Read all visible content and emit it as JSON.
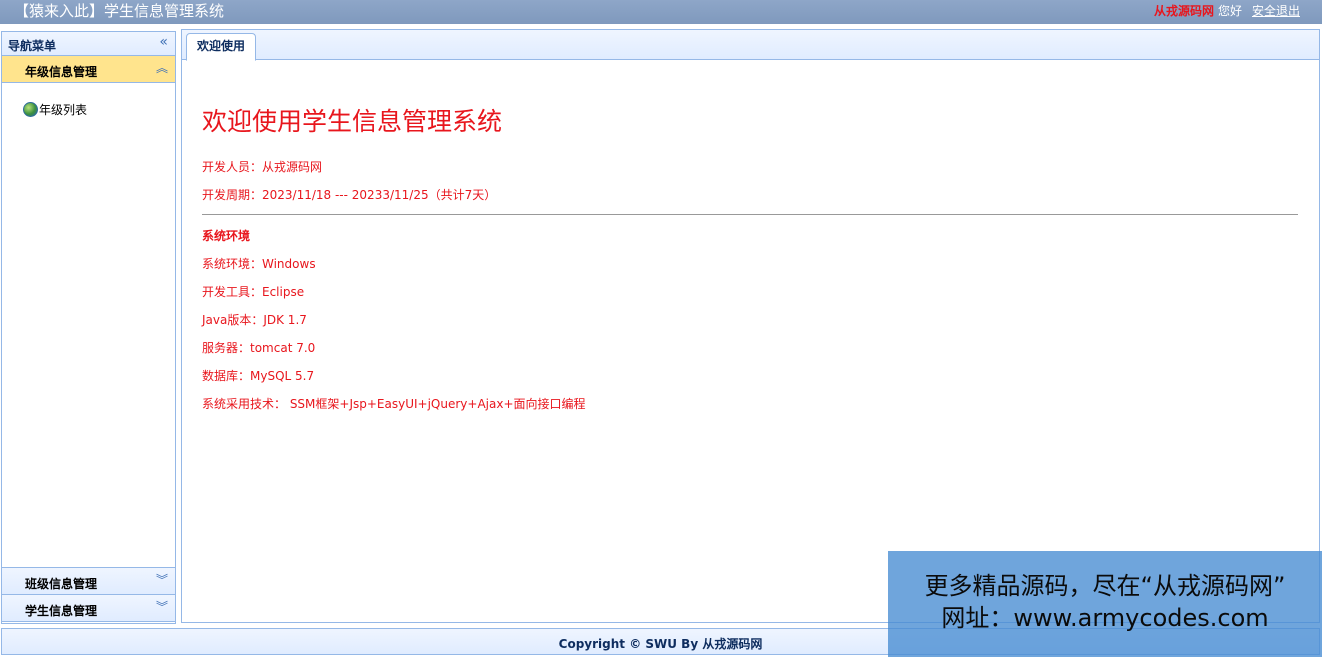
{
  "app": {
    "title": "【猿来入此】学生信息管理系统",
    "username": "从戎源码网",
    "greeting": "您好",
    "logout_label": "安全退出"
  },
  "sidebar": {
    "title": "导航菜单",
    "collapse_icon": "double-chevron-left-icon",
    "sections": [
      {
        "title": "年级信息管理",
        "expanded": true,
        "items": [
          {
            "label": "年级列表",
            "icon": "globe-icon"
          }
        ]
      },
      {
        "title": "班级信息管理",
        "expanded": false
      },
      {
        "title": "学生信息管理",
        "expanded": false
      }
    ]
  },
  "tabs": [
    {
      "label": "欢迎使用",
      "active": true
    }
  ],
  "welcome": {
    "heading": "欢迎使用学生信息管理系统",
    "developer": "开发人员：从戎源码网",
    "period": "开发周期：2023/11/18 --- 20233/11/25（共计7天）",
    "env_title": "系统环境",
    "env_os": "系统环境：Windows",
    "env_tool": "开发工具：Eclipse",
    "env_java": "Java版本：JDK 1.7",
    "env_server": "服务器：tomcat 7.0",
    "env_db": "数据库：MySQL 5.7",
    "env_tech": "系统采用技术： SSM框架+Jsp+EasyUI+jQuery+Ajax+面向接口编程"
  },
  "footer": {
    "copyright": "Copyright © SWU By 从戎源码网"
  },
  "watermark": {
    "line1": "更多精品源码，尽在“从戎源码网”",
    "line2": "网址：www.armycodes.com"
  },
  "colors": {
    "accent_red": "#e8161d",
    "header_blue": "#7f99bd",
    "border_blue": "#95b8e7",
    "active_section": "#ffe48d"
  }
}
